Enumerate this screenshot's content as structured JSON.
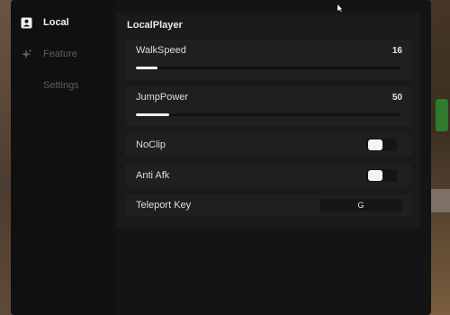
{
  "sidebar": {
    "items": [
      {
        "label": "Local",
        "icon": "user-icon",
        "active": true
      },
      {
        "label": "Feature",
        "icon": "sparkle-icon",
        "active": false
      },
      {
        "label": "Settings",
        "icon": "",
        "active": false
      }
    ]
  },
  "section": {
    "title": "LocalPlayer"
  },
  "walkspeed": {
    "label": "WalkSpeed",
    "value": "16"
  },
  "jumppower": {
    "label": "JumpPower",
    "value": "50"
  },
  "noclip": {
    "label": "NoClip"
  },
  "antiafk": {
    "label": "Anti Afk"
  },
  "teleport": {
    "label": "Teleport Key",
    "key": "G"
  },
  "colors": {
    "panel": "#141414",
    "sidebar": "#101010",
    "row": "#1f1f1f",
    "accent": "#f0f0f0"
  }
}
